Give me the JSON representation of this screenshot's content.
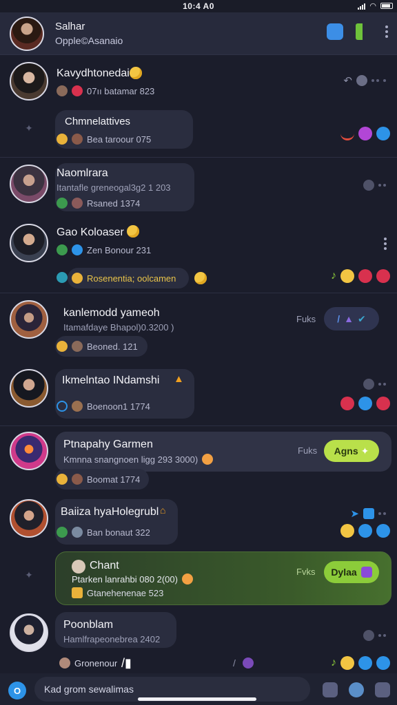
{
  "status": {
    "time": "10:4 A0",
    "battery": "100"
  },
  "header": {
    "title": "Salhar",
    "subtitle": "Opple©Asanaio"
  },
  "chats": [
    {
      "name": "Kavydhtonedai",
      "meta": "07ıı batamar 823"
    },
    {
      "name": "Chmnelattives",
      "meta": "Bea taroour 075"
    },
    {
      "name": "Naomlrara",
      "preview": "Itantafle greneogal3g2 1 203",
      "meta": "Rsaned 1374"
    },
    {
      "name": "Gao Koloaser",
      "meta": "Zen Bonour 231"
    },
    {
      "name": "Rosenentia; oolcamen"
    },
    {
      "name": "kanlemodd yameoh",
      "preview": "Itamafdaye Bhapol)0.3200 )",
      "meta": "Beoned. 121",
      "tag": "Fuks"
    },
    {
      "name": "Ikmelntao INdamshi",
      "meta": "Boenoon1 1774"
    },
    {
      "name": "Ptnapahy Garmen",
      "preview": "Kmnna snangnoen ligg 293 3000)",
      "meta": "Boomat 1774",
      "tag": "Fuks",
      "button": "Agns"
    },
    {
      "name": "Baiiza hyaHolegrubl",
      "meta": "Ban bonaut 322"
    },
    {
      "name": "Chant",
      "preview": "Ptarken lanrahbi 080 2(00)",
      "meta": "Gtanehenenae 523",
      "tag": "Fvks",
      "button": "Dylaa"
    },
    {
      "name": "Poonblam",
      "preview": "Hamlfrapeonebrea 2402",
      "meta": "Gronenour"
    }
  ],
  "input": {
    "placeholder": "Kad grom sewalimas",
    "bubble_letter": "O"
  },
  "colors": {
    "accent_green": "#8ccc3a",
    "accent_blue": "#2d93e8",
    "bg": "#1b1d2b"
  }
}
